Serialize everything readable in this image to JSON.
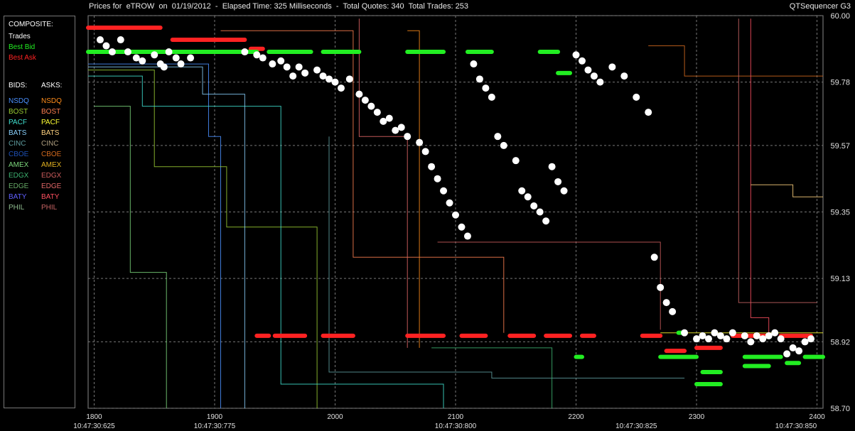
{
  "window": {
    "title": "Prices for  eTROW  on  01/19/2012  -  Elapsed Time: 325 Milliseconds  -  Total Quotes: 340  Total Trades: 253",
    "app_name": "QTSequencer G3"
  },
  "legend": {
    "composite_header": "COMPOSITE:",
    "composite": [
      {
        "label": "Trades",
        "color": "#ffffff"
      },
      {
        "label": "Best Bid",
        "color": "#22ee22"
      },
      {
        "label": "Best Ask",
        "color": "#ff2222"
      }
    ],
    "bids_header": "BIDS:",
    "asks_header": "ASKS:",
    "exchanges": [
      {
        "bid": "NSDQ",
        "bid_color": "#4a90ff",
        "ask": "NSDQ",
        "ask_color": "#ff8c1a"
      },
      {
        "bid": "BOST",
        "bid_color": "#9acd32",
        "ask": "BOST",
        "ask_color": "#ff7f50"
      },
      {
        "bid": "PACF",
        "bid_color": "#40e0d0",
        "ask": "PACF",
        "ask_color": "#ffff33"
      },
      {
        "bid": "BATS",
        "bid_color": "#87cefa",
        "ask": "BATS",
        "ask_color": "#ffd27f"
      },
      {
        "bid": "CINC",
        "bid_color": "#5f9ea0",
        "ask": "CINC",
        "ask_color": "#b0a080"
      },
      {
        "bid": "CBOE",
        "bid_color": "#1e50b4",
        "ask": "CBOE",
        "ask_color": "#d2691e"
      },
      {
        "bid": "AMEX",
        "bid_color": "#7cd67c",
        "ask": "AMEX",
        "ask_color": "#e0b020"
      },
      {
        "bid": "EDGX",
        "bid_color": "#3cb371",
        "ask": "EDGX",
        "ask_color": "#cd5c5c"
      },
      {
        "bid": "EDGE",
        "bid_color": "#66aa66",
        "ask": "EDGE",
        "ask_color": "#e06666"
      },
      {
        "bid": "BATY",
        "bid_color": "#6060ff",
        "ask": "BATY",
        "ask_color": "#ff5060"
      },
      {
        "bid": "PHIL",
        "bid_color": "#8fbc8f",
        "ask": "PHIL",
        "ask_color": "#c86464"
      }
    ]
  },
  "chart_data": {
    "type": "scatter",
    "title": "",
    "xlim": [
      1795,
      2405
    ],
    "ylim": [
      58.7,
      60.0
    ],
    "y_ticks": [
      "60.00",
      "59.78",
      "59.57",
      "59.35",
      "59.13",
      "58.92",
      "58.70"
    ],
    "x_ticks": [
      "1800",
      "1900",
      "2000",
      "2100",
      "2200",
      "2300",
      "2400"
    ],
    "x_time_labels": [
      {
        "x": 1800,
        "label": "10:47:30:625"
      },
      {
        "x": 1900,
        "label": "10:47:30:775"
      },
      {
        "x": 2100,
        "label": "10:47:30:800"
      },
      {
        "x": 2250,
        "label": "10:47:30:825"
      },
      {
        "x": 2400,
        "label": "10:47:30:850"
      }
    ],
    "grid": true,
    "series": [
      {
        "name": "Trades",
        "color": "#ffffff",
        "points": [
          [
            1805,
            59.92
          ],
          [
            1810,
            59.9
          ],
          [
            1815,
            59.88
          ],
          [
            1822,
            59.92
          ],
          [
            1828,
            59.88
          ],
          [
            1835,
            59.86
          ],
          [
            1840,
            59.85
          ],
          [
            1850,
            59.87
          ],
          [
            1855,
            59.84
          ],
          [
            1858,
            59.83
          ],
          [
            1862,
            59.88
          ],
          [
            1868,
            59.86
          ],
          [
            1872,
            59.84
          ],
          [
            1880,
            59.86
          ],
          [
            1925,
            59.88
          ],
          [
            1935,
            59.87
          ],
          [
            1940,
            59.86
          ],
          [
            1948,
            59.84
          ],
          [
            1955,
            59.85
          ],
          [
            1960,
            59.83
          ],
          [
            1965,
            59.8
          ],
          [
            1970,
            59.83
          ],
          [
            1975,
            59.81
          ],
          [
            1985,
            59.82
          ],
          [
            1990,
            59.8
          ],
          [
            1995,
            59.79
          ],
          [
            2000,
            59.78
          ],
          [
            2005,
            59.76
          ],
          [
            2012,
            59.79
          ],
          [
            2020,
            59.74
          ],
          [
            2025,
            59.72
          ],
          [
            2030,
            59.7
          ],
          [
            2035,
            59.68
          ],
          [
            2040,
            59.65
          ],
          [
            2045,
            59.66
          ],
          [
            2050,
            59.62
          ],
          [
            2055,
            59.63
          ],
          [
            2060,
            59.6
          ],
          [
            2070,
            59.58
          ],
          [
            2075,
            59.55
          ],
          [
            2080,
            59.5
          ],
          [
            2085,
            59.46
          ],
          [
            2090,
            59.42
          ],
          [
            2095,
            59.38
          ],
          [
            2100,
            59.34
          ],
          [
            2105,
            59.3
          ],
          [
            2110,
            59.27
          ],
          [
            2115,
            59.84
          ],
          [
            2120,
            59.79
          ],
          [
            2125,
            59.76
          ],
          [
            2130,
            59.73
          ],
          [
            2135,
            59.6
          ],
          [
            2140,
            59.57
          ],
          [
            2150,
            59.52
          ],
          [
            2155,
            59.42
          ],
          [
            2160,
            59.4
          ],
          [
            2165,
            59.37
          ],
          [
            2170,
            59.35
          ],
          [
            2175,
            59.32
          ],
          [
            2180,
            59.5
          ],
          [
            2185,
            59.45
          ],
          [
            2190,
            59.42
          ],
          [
            2200,
            59.87
          ],
          [
            2205,
            59.85
          ],
          [
            2210,
            59.82
          ],
          [
            2215,
            59.8
          ],
          [
            2220,
            59.78
          ],
          [
            2230,
            59.83
          ],
          [
            2240,
            59.8
          ],
          [
            2250,
            59.73
          ],
          [
            2260,
            59.68
          ],
          [
            2265,
            59.2
          ],
          [
            2270,
            59.1
          ],
          [
            2275,
            59.05
          ],
          [
            2280,
            59.02
          ],
          [
            2290,
            58.95
          ],
          [
            2300,
            58.93
          ],
          [
            2305,
            58.94
          ],
          [
            2310,
            58.93
          ],
          [
            2315,
            58.95
          ],
          [
            2320,
            58.94
          ],
          [
            2325,
            58.93
          ],
          [
            2330,
            58.95
          ],
          [
            2340,
            58.94
          ],
          [
            2345,
            58.92
          ],
          [
            2350,
            58.94
          ],
          [
            2355,
            58.93
          ],
          [
            2360,
            58.94
          ],
          [
            2365,
            58.95
          ],
          [
            2370,
            58.93
          ],
          [
            2375,
            58.88
          ],
          [
            2380,
            58.9
          ],
          [
            2385,
            58.89
          ],
          [
            2390,
            58.92
          ],
          [
            2395,
            58.93
          ]
        ]
      },
      {
        "name": "Best Bid",
        "color": "#22ee22",
        "segments": [
          [
            1795,
            1935,
            59.88
          ],
          [
            1945,
            1980,
            59.88
          ],
          [
            1990,
            2020,
            59.88
          ],
          [
            2060,
            2090,
            59.88
          ],
          [
            2110,
            2130,
            59.88
          ],
          [
            2170,
            2185,
            59.88
          ],
          [
            2185,
            2195,
            59.81
          ],
          [
            2270,
            2300,
            58.87
          ],
          [
            2285,
            2290,
            58.95
          ],
          [
            2305,
            2320,
            58.82
          ],
          [
            2340,
            2360,
            58.84
          ],
          [
            2375,
            2385,
            58.85
          ],
          [
            2390,
            2405,
            58.87
          ],
          [
            2300,
            2320,
            58.78
          ],
          [
            2340,
            2370,
            58.87
          ],
          [
            2200,
            2205,
            58.87
          ]
        ]
      },
      {
        "name": "Best Ask",
        "color": "#ff2222",
        "segments": [
          [
            1795,
            1855,
            59.96
          ],
          [
            1865,
            1925,
            59.92
          ],
          [
            1930,
            1940,
            59.89
          ],
          [
            1935,
            1945,
            58.94
          ],
          [
            1950,
            1975,
            58.94
          ],
          [
            1990,
            2015,
            58.94
          ],
          [
            2060,
            2090,
            58.94
          ],
          [
            2105,
            2125,
            58.94
          ],
          [
            2145,
            2165,
            58.94
          ],
          [
            2175,
            2195,
            58.94
          ],
          [
            2205,
            2215,
            58.94
          ],
          [
            2255,
            2270,
            58.94
          ],
          [
            2275,
            2290,
            58.89
          ],
          [
            2300,
            2320,
            58.9
          ],
          [
            2330,
            2360,
            58.94
          ],
          [
            2370,
            2395,
            58.94
          ]
        ]
      }
    ]
  }
}
